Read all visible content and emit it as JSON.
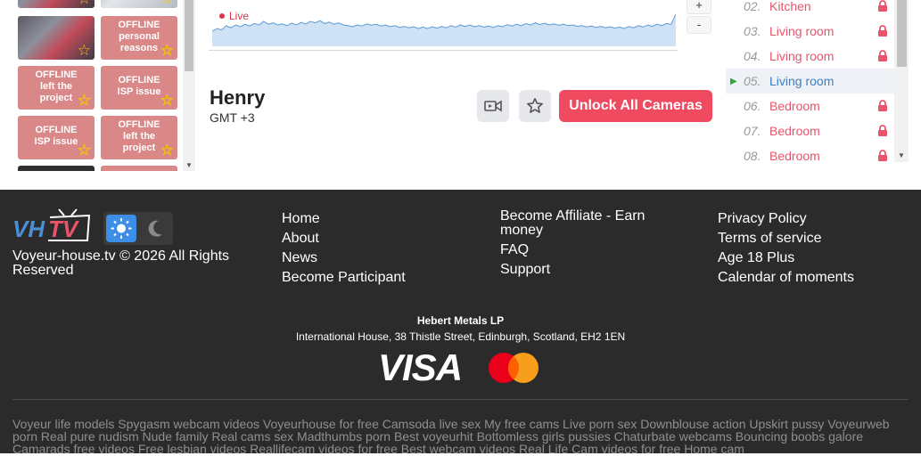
{
  "thumbs": [
    {
      "status": "",
      "kind": "photo"
    },
    {
      "status": "",
      "kind": "photo2"
    },
    {
      "status": "",
      "kind": "photo"
    },
    {
      "status": "OFFLINE\npersonal\nreasons",
      "kind": "off"
    },
    {
      "status": "OFFLINE\nleft the\nproject",
      "kind": "off"
    },
    {
      "status": "OFFLINE\nISP issue",
      "kind": "off"
    },
    {
      "status": "OFFLINE\nISP issue",
      "kind": "off"
    },
    {
      "status": "OFFLINE\nleft the\nproject",
      "kind": "off"
    }
  ],
  "chart": {
    "live_label": "Live",
    "zoom_in": "+",
    "zoom_out": "-"
  },
  "chart_data": {
    "type": "area",
    "title": "",
    "xlabel": "",
    "ylabel": "",
    "series": [
      {
        "values": [
          0.42,
          0.5,
          0.46,
          0.58,
          0.52,
          0.6,
          0.55,
          0.62,
          0.57,
          0.64,
          0.6,
          0.7,
          0.62,
          0.66,
          0.6,
          0.63,
          0.58,
          0.65,
          0.6,
          0.67,
          0.63,
          0.7,
          0.66,
          0.72,
          0.64,
          0.68,
          0.62,
          0.66,
          0.6,
          0.58,
          0.55,
          0.6,
          0.57,
          0.63,
          0.59,
          0.62,
          0.57,
          0.6,
          0.55,
          0.58,
          0.53,
          0.56,
          0.52,
          0.55,
          0.5,
          0.54,
          0.5,
          0.55,
          0.51,
          0.56,
          0.52,
          0.58,
          0.54,
          0.6,
          0.56,
          0.6,
          0.55,
          0.58,
          0.54,
          0.57,
          0.53,
          0.58,
          0.55,
          0.61,
          0.57,
          0.62,
          0.58,
          0.64,
          0.6,
          0.66,
          0.61,
          0.65,
          0.6,
          0.63,
          0.59,
          0.62,
          0.58,
          0.6,
          0.56,
          0.58,
          0.54,
          0.57,
          0.53,
          0.56,
          0.52,
          0.55,
          0.51,
          0.54,
          0.5,
          0.56,
          0.52,
          0.58,
          0.54,
          0.6,
          0.56,
          0.62,
          0.58,
          0.64,
          0.62,
          0.9
        ]
      }
    ]
  },
  "profile": {
    "name": "Henry",
    "timezone": "GMT +3",
    "video_icon": "video-camera-icon",
    "favorite_icon": "star-icon",
    "unlock_label": "Unlock All Cameras"
  },
  "rooms": [
    {
      "num": "02.",
      "label": "Kitchen",
      "locked": true,
      "active": false
    },
    {
      "num": "03.",
      "label": "Living room",
      "locked": true,
      "active": false
    },
    {
      "num": "04.",
      "label": "Living room",
      "locked": true,
      "active": false
    },
    {
      "num": "05.",
      "label": "Living room",
      "locked": false,
      "active": true
    },
    {
      "num": "06.",
      "label": "Bedroom",
      "locked": true,
      "active": false
    },
    {
      "num": "07.",
      "label": "Bedroom",
      "locked": true,
      "active": false
    },
    {
      "num": "08.",
      "label": "Bedroom",
      "locked": true,
      "active": false
    }
  ],
  "footer": {
    "logo_text": "VHTV",
    "copyright": "Voyeur-house.tv © 2026 All Rights Reserved",
    "col1": [
      "Home",
      "About",
      "News",
      "Become Participant"
    ],
    "col2": [
      "Become Affiliate - Earn money",
      "FAQ",
      "Support"
    ],
    "col3": [
      "Privacy Policy",
      "Terms of service",
      "Age 18 Plus",
      "Calendar of moments"
    ],
    "company": "Hebert Metals LP",
    "address": "International House, 38 Thistle Street, Edinburgh, Scotland, EH2 1EN",
    "visa": "VISA",
    "tags": "Voyeur life models Spygasm webcam videos Voyeurhouse for free Camsoda live sex My free cams Live porn sex Downblouse action Upskirt pussy Voyeurweb porn Real pure nudism Nude family Real cams sex Madthumbs porn Best voyeurhit Bottomless girls pussies Chaturbate webcams Bouncing boobs galore Camarads free videos Free lesbian videos Reallifecam videos for free Best webcam videos Real Life Cam videos for free Home cam"
  },
  "colors": {
    "accent": "#f04a60",
    "room_link": "#e8546a",
    "room_active": "#3c7fc4",
    "footer_bg": "#2b2b2b",
    "chart_line": "#5b9bd5"
  }
}
